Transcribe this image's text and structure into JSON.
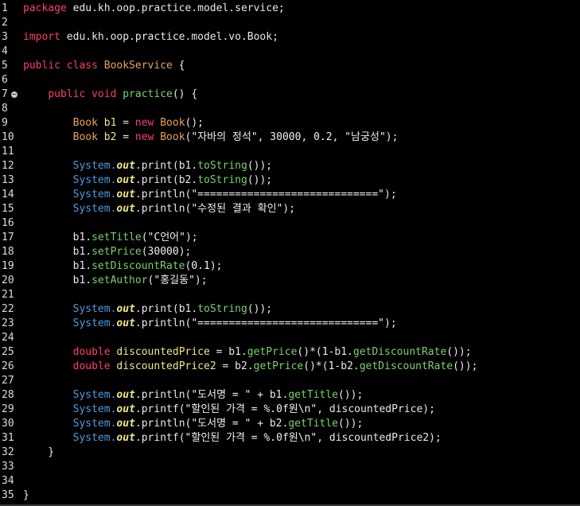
{
  "editor": {
    "fold_marker_line": 7,
    "line_numbers": [
      "1",
      "2",
      "3",
      "4",
      "5",
      "6",
      "7",
      "8",
      "9",
      "10",
      "11",
      "12",
      "13",
      "14",
      "15",
      "16",
      "17",
      "18",
      "19",
      "20",
      "21",
      "22",
      "23",
      "24",
      "25",
      "26",
      "27",
      "28",
      "29",
      "30",
      "31",
      "32",
      "33",
      "34",
      "35"
    ],
    "lines": [
      [
        [
          "kw",
          "package"
        ],
        [
          "pkg",
          " edu.kh.oop.practice.model.service;"
        ]
      ],
      [],
      [
        [
          "kw",
          "import"
        ],
        [
          "pkg",
          " edu.kh.oop.practice.model.vo.Book;"
        ]
      ],
      [],
      [
        [
          "kw",
          "public class "
        ],
        [
          "cls",
          "BookService"
        ],
        [
          "pun",
          " {"
        ]
      ],
      [],
      [
        [
          "pun",
          "    "
        ],
        [
          "kw",
          "public void "
        ],
        [
          "mth",
          "practice"
        ],
        [
          "pun",
          "() {"
        ]
      ],
      [],
      [
        [
          "pun",
          "        "
        ],
        [
          "cls",
          "Book "
        ],
        [
          "var",
          "b1"
        ],
        [
          "pun",
          " = "
        ],
        [
          "kw",
          "new "
        ],
        [
          "cls",
          "Book"
        ],
        [
          "pun",
          "();"
        ]
      ],
      [
        [
          "pun",
          "        "
        ],
        [
          "cls",
          "Book "
        ],
        [
          "var",
          "b2"
        ],
        [
          "pun",
          " = "
        ],
        [
          "kw",
          "new "
        ],
        [
          "cls",
          "Book"
        ],
        [
          "pun",
          "("
        ],
        [
          "str",
          "\"자바의 정석\""
        ],
        [
          "pun",
          ", "
        ],
        [
          "num",
          "30000"
        ],
        [
          "pun",
          ", "
        ],
        [
          "num",
          "0.2"
        ],
        [
          "pun",
          ", "
        ],
        [
          "str",
          "\"남궁성\""
        ],
        [
          "pun",
          ");"
        ]
      ],
      [],
      [
        [
          "pun",
          "        "
        ],
        [
          "sys",
          "System."
        ],
        [
          "fld",
          "out"
        ],
        [
          "pun",
          "."
        ],
        [
          "call",
          "print"
        ],
        [
          "pun",
          "(b1."
        ],
        [
          "mth",
          "toString"
        ],
        [
          "pun",
          "());"
        ]
      ],
      [
        [
          "pun",
          "        "
        ],
        [
          "sys",
          "System."
        ],
        [
          "fld",
          "out"
        ],
        [
          "pun",
          "."
        ],
        [
          "call",
          "print"
        ],
        [
          "pun",
          "(b2."
        ],
        [
          "mth",
          "toString"
        ],
        [
          "pun",
          "());"
        ]
      ],
      [
        [
          "pun",
          "        "
        ],
        [
          "sys",
          "System."
        ],
        [
          "fld",
          "out"
        ],
        [
          "pun",
          "."
        ],
        [
          "call",
          "println"
        ],
        [
          "pun",
          "("
        ],
        [
          "str",
          "\"=============================\""
        ],
        [
          "pun",
          ");"
        ]
      ],
      [
        [
          "pun",
          "        "
        ],
        [
          "sys",
          "System."
        ],
        [
          "fld",
          "out"
        ],
        [
          "pun",
          "."
        ],
        [
          "call",
          "println"
        ],
        [
          "pun",
          "("
        ],
        [
          "str",
          "\"수정된 결과 확인\""
        ],
        [
          "pun",
          ");"
        ]
      ],
      [],
      [
        [
          "pun",
          "        b1."
        ],
        [
          "mth",
          "setTitle"
        ],
        [
          "pun",
          "("
        ],
        [
          "str",
          "\"C언어\""
        ],
        [
          "pun",
          ");"
        ]
      ],
      [
        [
          "pun",
          "        b1."
        ],
        [
          "mth",
          "setPrice"
        ],
        [
          "pun",
          "("
        ],
        [
          "num",
          "30000"
        ],
        [
          "pun",
          ");"
        ]
      ],
      [
        [
          "pun",
          "        b1."
        ],
        [
          "mth",
          "setDiscountRate"
        ],
        [
          "pun",
          "("
        ],
        [
          "num",
          "0.1"
        ],
        [
          "pun",
          ");"
        ]
      ],
      [
        [
          "pun",
          "        b1."
        ],
        [
          "mth",
          "setAuthor"
        ],
        [
          "pun",
          "("
        ],
        [
          "str",
          "\"홍길동\""
        ],
        [
          "pun",
          ");"
        ]
      ],
      [],
      [
        [
          "pun",
          "        "
        ],
        [
          "sys",
          "System."
        ],
        [
          "fld",
          "out"
        ],
        [
          "pun",
          "."
        ],
        [
          "call",
          "print"
        ],
        [
          "pun",
          "(b1."
        ],
        [
          "mth",
          "toString"
        ],
        [
          "pun",
          "());"
        ]
      ],
      [
        [
          "pun",
          "        "
        ],
        [
          "sys",
          "System."
        ],
        [
          "fld",
          "out"
        ],
        [
          "pun",
          "."
        ],
        [
          "call",
          "println"
        ],
        [
          "pun",
          "("
        ],
        [
          "str",
          "\"=============================\""
        ],
        [
          "pun",
          ");"
        ]
      ],
      [],
      [
        [
          "pun",
          "        "
        ],
        [
          "kw",
          "double "
        ],
        [
          "var",
          "discountedPrice"
        ],
        [
          "pun",
          " = b1."
        ],
        [
          "mth",
          "getPrice"
        ],
        [
          "pun",
          "()*("
        ],
        [
          "num",
          "1"
        ],
        [
          "pun",
          "-b1."
        ],
        [
          "mth",
          "getDiscountRate"
        ],
        [
          "pun",
          "());"
        ]
      ],
      [
        [
          "pun",
          "        "
        ],
        [
          "kw",
          "double "
        ],
        [
          "var",
          "discountedPrice2"
        ],
        [
          "pun",
          " = b2."
        ],
        [
          "mth",
          "getPrice"
        ],
        [
          "pun",
          "()*("
        ],
        [
          "num",
          "1"
        ],
        [
          "pun",
          "-b2."
        ],
        [
          "mth",
          "getDiscountRate"
        ],
        [
          "pun",
          "());"
        ]
      ],
      [],
      [
        [
          "pun",
          "        "
        ],
        [
          "sys",
          "System."
        ],
        [
          "fld",
          "out"
        ],
        [
          "pun",
          "."
        ],
        [
          "call",
          "println"
        ],
        [
          "pun",
          "("
        ],
        [
          "str",
          "\"도서명 = \""
        ],
        [
          "pun",
          " + b1."
        ],
        [
          "mth",
          "getTitle"
        ],
        [
          "pun",
          "());"
        ]
      ],
      [
        [
          "pun",
          "        "
        ],
        [
          "sys",
          "System."
        ],
        [
          "fld",
          "out"
        ],
        [
          "pun",
          "."
        ],
        [
          "call",
          "printf"
        ],
        [
          "pun",
          "("
        ],
        [
          "str",
          "\"할인된 가격 = %.0f원\\n\""
        ],
        [
          "pun",
          ", discountedPrice);"
        ]
      ],
      [
        [
          "pun",
          "        "
        ],
        [
          "sys",
          "System."
        ],
        [
          "fld",
          "out"
        ],
        [
          "pun",
          "."
        ],
        [
          "call",
          "println"
        ],
        [
          "pun",
          "("
        ],
        [
          "str",
          "\"도서명 = \""
        ],
        [
          "pun",
          " + b2."
        ],
        [
          "mth",
          "getTitle"
        ],
        [
          "pun",
          "());"
        ]
      ],
      [
        [
          "pun",
          "        "
        ],
        [
          "sys",
          "System."
        ],
        [
          "fld",
          "out"
        ],
        [
          "pun",
          "."
        ],
        [
          "call",
          "printf"
        ],
        [
          "pun",
          "("
        ],
        [
          "str",
          "\"할인된 가격 = %.0f원\\n\""
        ],
        [
          "pun",
          ", discountedPrice2);"
        ]
      ],
      [
        [
          "pun",
          "    }"
        ]
      ],
      [],
      [],
      [
        [
          "pun",
          "}"
        ]
      ]
    ]
  }
}
